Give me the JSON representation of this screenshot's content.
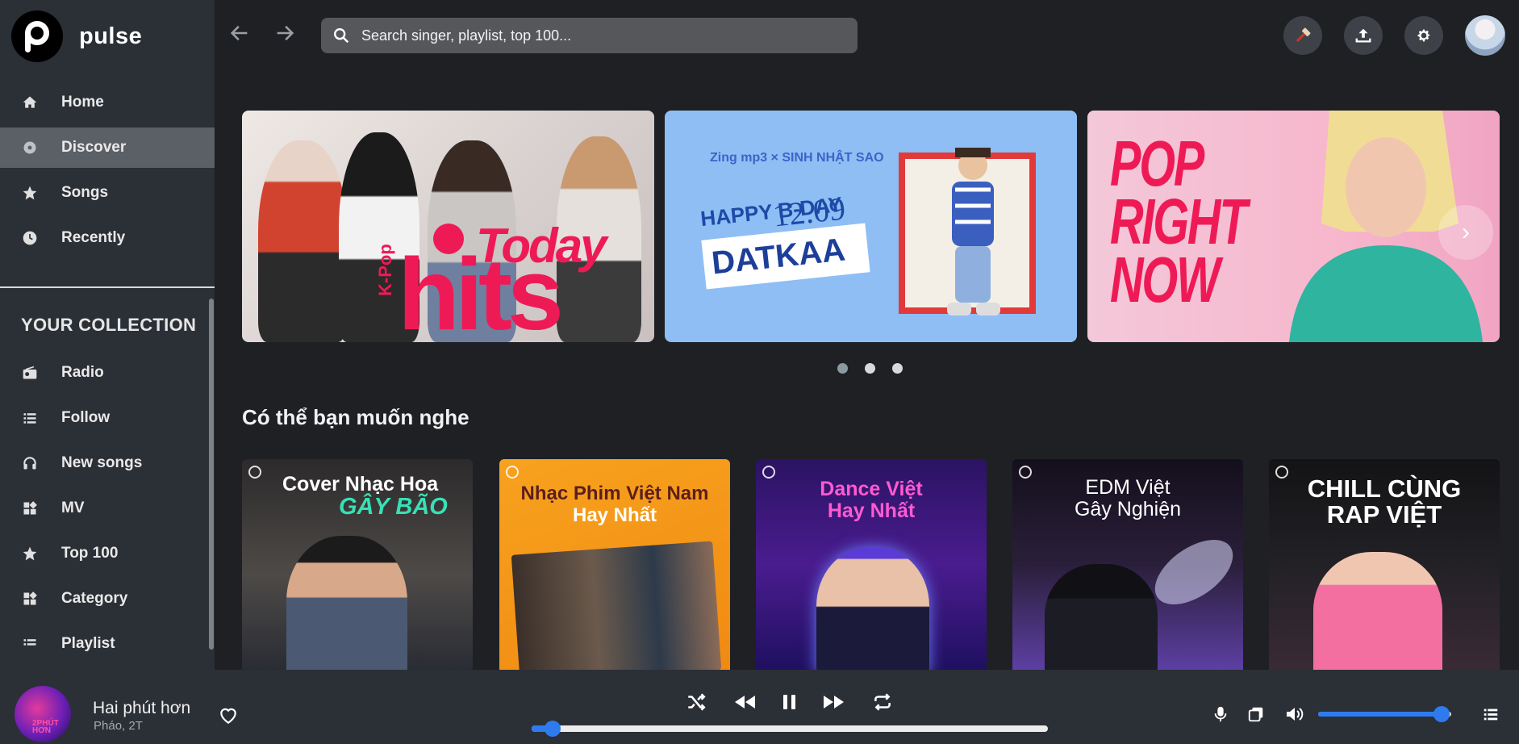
{
  "app": {
    "name": "pulse"
  },
  "sidebar": {
    "main_items": [
      {
        "label": "Home",
        "icon": "home-icon"
      },
      {
        "label": "Discover",
        "icon": "disc-icon",
        "active": true
      },
      {
        "label": "Songs",
        "icon": "star-icon"
      },
      {
        "label": "Recently",
        "icon": "clock-icon"
      }
    ],
    "collection_title": "YOUR COLLECTION",
    "collection_items": [
      {
        "label": "Radio",
        "icon": "radio-icon"
      },
      {
        "label": "Follow",
        "icon": "list-icon"
      },
      {
        "label": "New songs",
        "icon": "headphones-icon"
      },
      {
        "label": "MV",
        "icon": "grid-icon"
      },
      {
        "label": "Top 100",
        "icon": "star-icon"
      },
      {
        "label": "Category",
        "icon": "grid-icon"
      },
      {
        "label": "Playlist",
        "icon": "list-icon"
      }
    ]
  },
  "search": {
    "placeholder": "Search singer, playlist, top 100..."
  },
  "banners": [
    {
      "text_1": "Today",
      "text_2": "hits",
      "text_3": "K-Pop"
    },
    {
      "brand": "Zing mp3 × SINH NHẬT SAO",
      "greeting": "HAPPY B-DAY",
      "date": "12.09",
      "name": "DATKAA"
    },
    {
      "line_1": "POP",
      "line_2": "RIGHT",
      "line_3": "NOW"
    }
  ],
  "carousel": {
    "dots": 3,
    "active_dot": 0,
    "next_glyph": "›"
  },
  "section": {
    "title": "Có thể bạn muốn nghe"
  },
  "cards": [
    {
      "line_1": "Cover Nhạc Hoa",
      "line_2": "GÂY BÃO"
    },
    {
      "line_1": "Nhạc Phim Việt Nam",
      "line_2": "Hay Nhất"
    },
    {
      "line_1": "Dance Việt",
      "line_2": "Hay Nhất"
    },
    {
      "line_1": "EDM Việt",
      "line_2": "Gây Nghiện"
    },
    {
      "line_1": "CHILL CÙNG",
      "line_2": "RAP VIỆT"
    }
  ],
  "player": {
    "title": "Hai phút hơn",
    "artist": "Pháo, 2T",
    "cover_text": "2PHÚT HƠN",
    "progress": 0.04,
    "volume": 0.93
  },
  "colors": {
    "accent": "#2e7bf0",
    "brand_pink": "#ee1a56",
    "sidebar": "#2b2f36",
    "background": "#1e2024"
  }
}
